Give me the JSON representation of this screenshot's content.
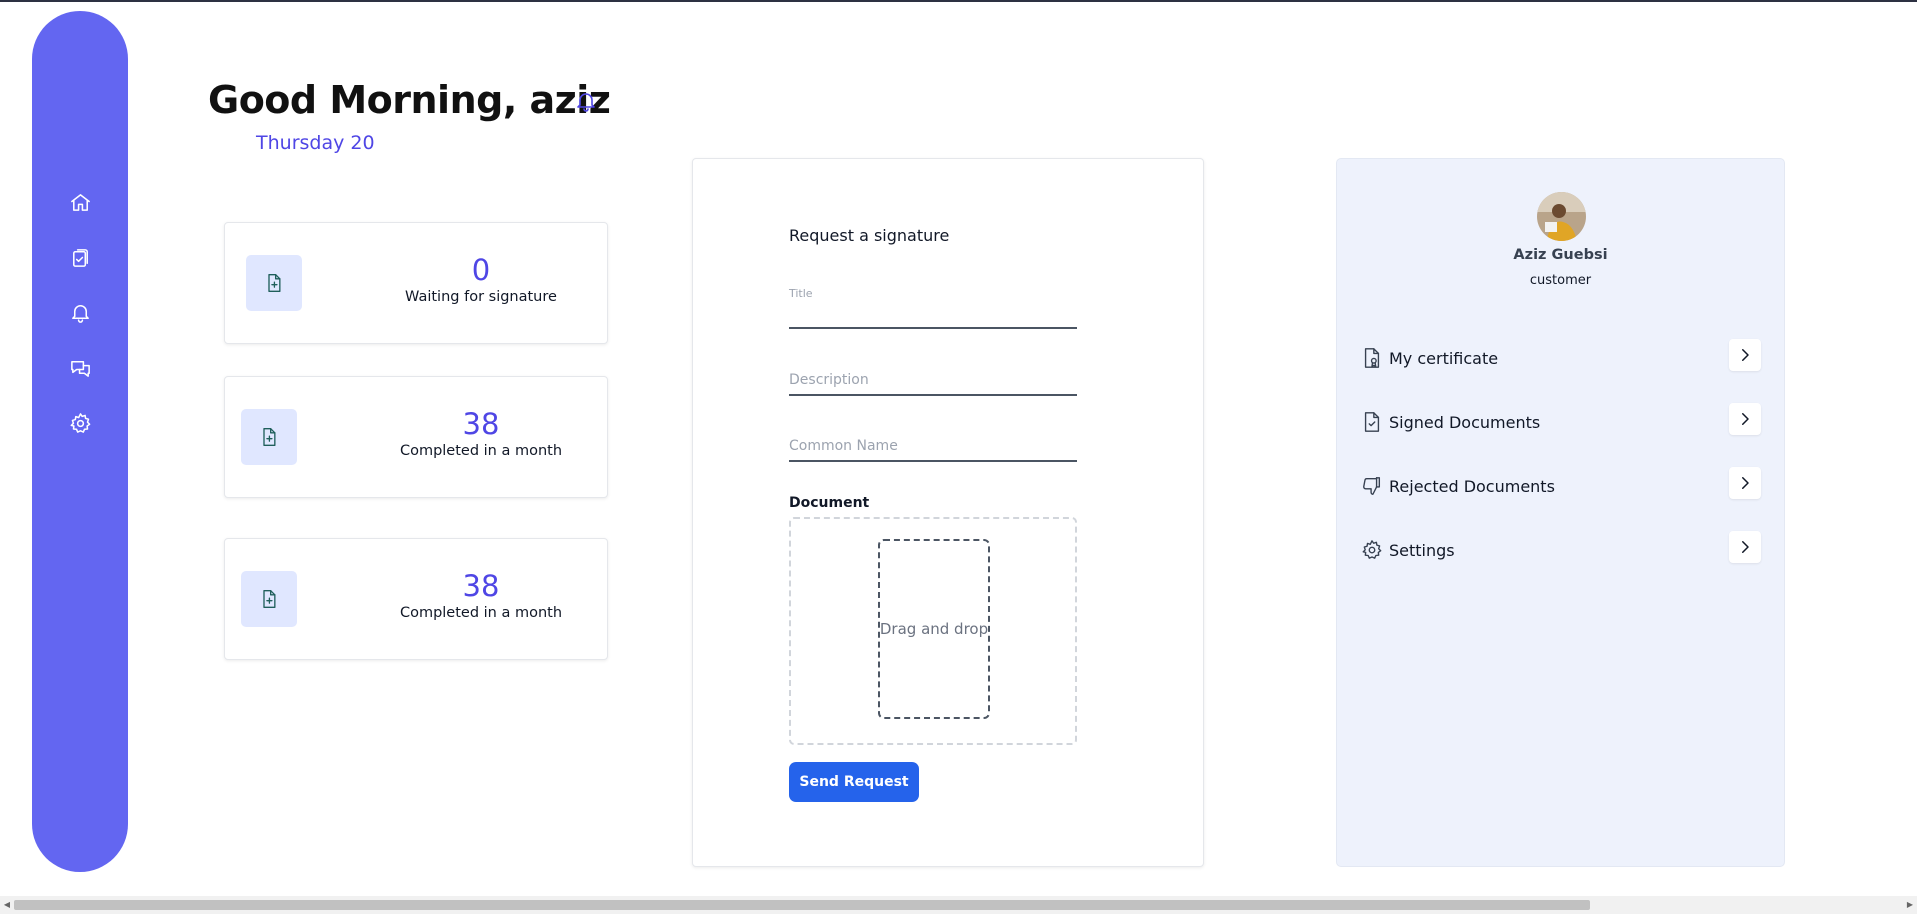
{
  "header": {
    "greeting": "Good Morning, aziz",
    "date": "Thursday 20"
  },
  "sidebar": {
    "items": [
      {
        "name": "home",
        "icon": "home-icon"
      },
      {
        "name": "documents",
        "icon": "clipboard-check-icon"
      },
      {
        "name": "notifications",
        "icon": "bell-icon"
      },
      {
        "name": "messages",
        "icon": "chat-icon"
      },
      {
        "name": "settings",
        "icon": "gear-icon"
      }
    ]
  },
  "stats": [
    {
      "value": "0",
      "label": "Waiting for signature",
      "icon": "file-plus-icon"
    },
    {
      "value": "38",
      "label": "Completed in a month",
      "icon": "file-plus-icon"
    },
    {
      "value": "38",
      "label": "Completed in a month",
      "icon": "file-plus-icon"
    }
  ],
  "form": {
    "title": "Request a signature",
    "title_field_label": "Title",
    "description_placeholder": "Description",
    "common_name_placeholder": "Common Name",
    "document_label": "Document",
    "dropzone_text": "Drag and drop",
    "submit_label": "Send Request"
  },
  "profile": {
    "name": "Aziz Guebsi",
    "role": "customer",
    "menu": [
      {
        "label": "My certificate",
        "icon": "certificate-icon"
      },
      {
        "label": "Signed Documents",
        "icon": "file-check-icon"
      },
      {
        "label": "Rejected Documents",
        "icon": "thumbs-down-icon"
      },
      {
        "label": "Settings",
        "icon": "gear-icon"
      }
    ]
  },
  "colors": {
    "sidebar": "#6366f1",
    "accent": "#4f46e5",
    "button": "#2563eb",
    "profile_bg": "#eef2fc",
    "icon_bg": "#e0e7ff"
  }
}
